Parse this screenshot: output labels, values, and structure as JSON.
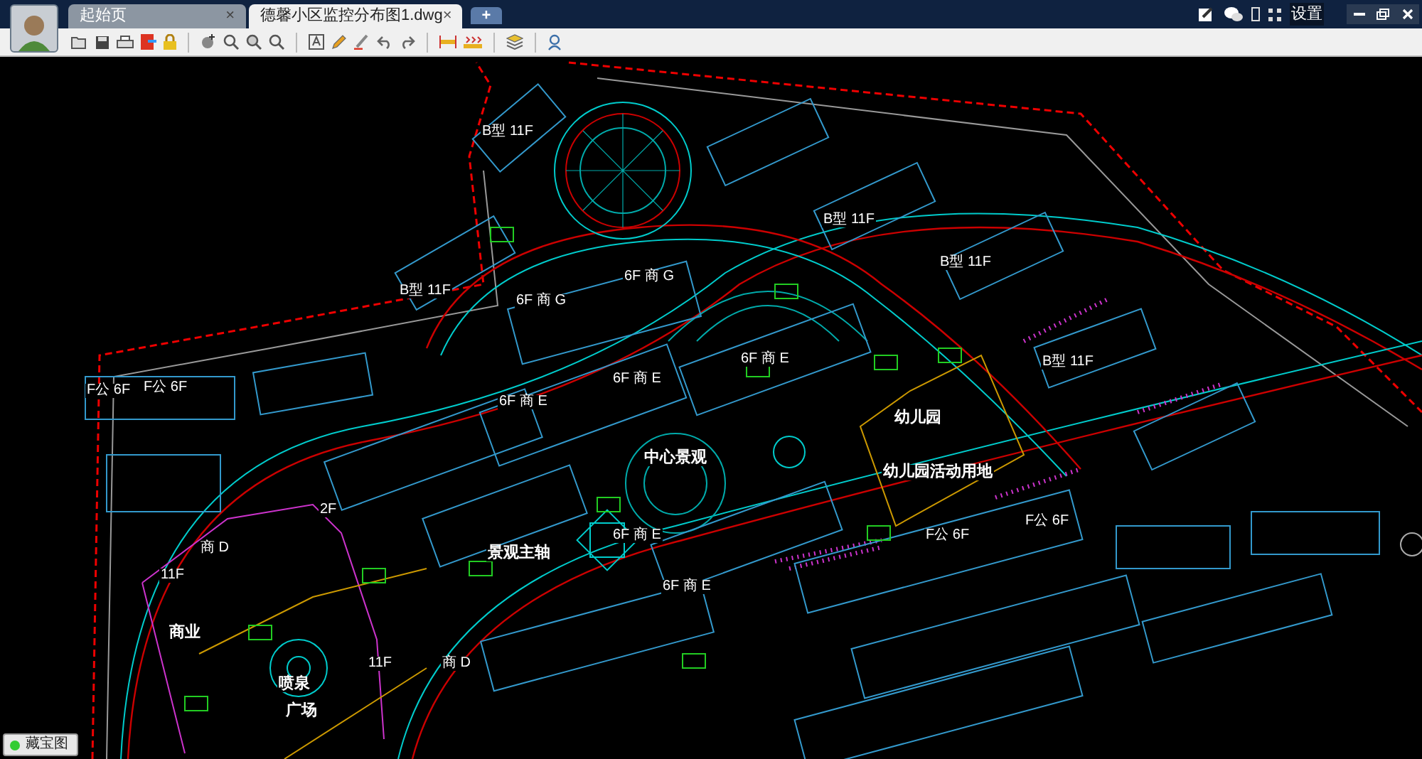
{
  "tabs": [
    {
      "label": "起始页",
      "selected": false,
      "close": "×"
    },
    {
      "label": "德馨小区监控分布图1.dwg",
      "selected": true,
      "close": "×"
    }
  ],
  "new_tab": "+",
  "settings": "设置",
  "drawing_labels": [
    {
      "text": "幼儿园",
      "kind": "area"
    },
    {
      "text": "幼儿园活动用地",
      "kind": "area"
    },
    {
      "text": "中心景观",
      "kind": "area"
    },
    {
      "text": "景观主轴",
      "kind": "area"
    },
    {
      "text": "商业",
      "kind": "area"
    },
    {
      "text": "喷泉",
      "kind": "area"
    },
    {
      "text": "广场",
      "kind": "area"
    },
    {
      "text": "B型 11F",
      "kind": "building"
    },
    {
      "text": "B型 11F",
      "kind": "building"
    },
    {
      "text": "B型 11F",
      "kind": "building"
    },
    {
      "text": "B型 11F",
      "kind": "building"
    },
    {
      "text": "B型 11F",
      "kind": "building"
    },
    {
      "text": "6F 商 G",
      "kind": "building"
    },
    {
      "text": "6F 商 G",
      "kind": "building"
    },
    {
      "text": "6F 商 E",
      "kind": "building"
    },
    {
      "text": "6F 商 E",
      "kind": "building"
    },
    {
      "text": "6F 商 E",
      "kind": "building"
    },
    {
      "text": "6F 商 E",
      "kind": "building"
    },
    {
      "text": "6F 商 E",
      "kind": "building"
    },
    {
      "text": "F公 6F",
      "kind": "building"
    },
    {
      "text": "F公 6F",
      "kind": "building"
    },
    {
      "text": "F公 6F",
      "kind": "building"
    },
    {
      "text": "F公 6F",
      "kind": "building"
    },
    {
      "text": "商 D",
      "kind": "building"
    },
    {
      "text": "商 D",
      "kind": "building"
    },
    {
      "text": "11F",
      "kind": "building"
    },
    {
      "text": "11F",
      "kind": "building"
    },
    {
      "text": "2F",
      "kind": "building"
    }
  ],
  "map_button": {
    "label": "藏宝图"
  }
}
